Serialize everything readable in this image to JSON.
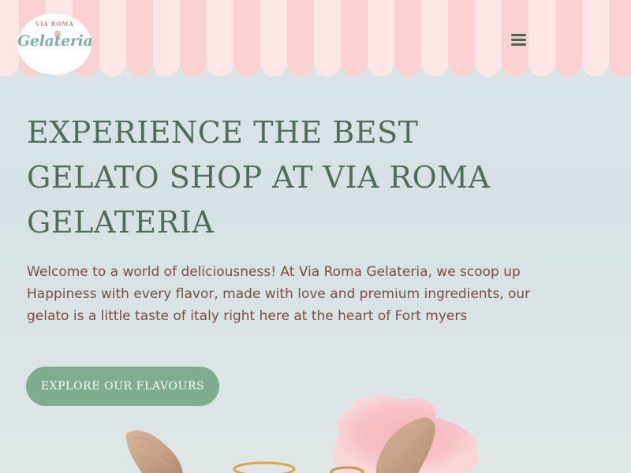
{
  "colors": {
    "stripe_light": "#fde6e6",
    "stripe_pink": "#fcd1d1",
    "heading": "#4f6e58",
    "body_text": "#7b4d40",
    "cta_background": "#7eae8d",
    "cta_text": "#ffffff",
    "logo_script": "#7fb0a5",
    "logo_top": "#c98e8e",
    "menu_icon": "#4d6659"
  },
  "header": {
    "logo": {
      "top_text": "VIA ROMA",
      "main_text": "Gelateria",
      "icon": "ice-cream-cone-icon"
    },
    "menu_icon": "hamburger-menu-icon"
  },
  "hero": {
    "title_lines": [
      "Experience the best",
      "Gelato shop at Via Roma",
      "Gelateria"
    ],
    "intro_lines": [
      "Welcome to a world of deliciousness! At Via Roma Gelateria, we scoop up",
      "Happiness with every flavor, made with love and premium ingredients, our",
      "gelato is a little taste of italy right here at the heart of Fort myers"
    ],
    "cta_label": "Explore our flavours",
    "image_icon": "winged-gelato-cups-image"
  }
}
